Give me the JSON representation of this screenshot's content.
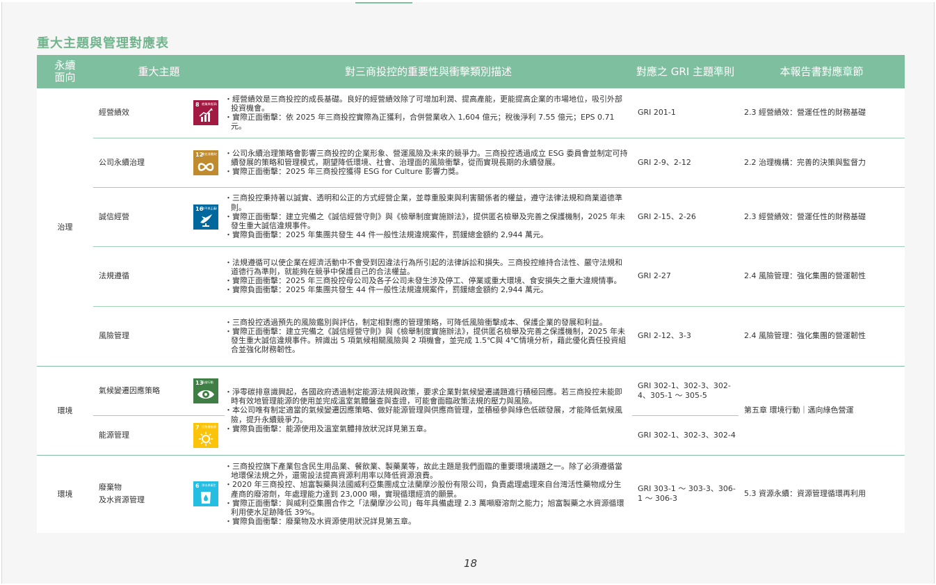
{
  "title": "重大主題與管理對應表",
  "page_number": "18",
  "headers": {
    "pillar": "永續\n面向",
    "topic": "重大主題",
    "description": "對三商投控的重要性與衝擊類別描述",
    "gri": "對應之 GRI 主題準則",
    "section": "本報告書對應章節"
  },
  "colors": {
    "accent": "#7dbf9e",
    "title": "#72b48e",
    "sdg8": "#a21942",
    "sdg12": "#bf8b2e",
    "sdg16": "#00689d",
    "sdg13": "#3f7e44",
    "sdg7": "#fcc30b",
    "sdg6": "#26bde2"
  },
  "sdg_icons": {
    "sdg8": {
      "num": "8",
      "text": "就業與經濟成長",
      "icon": "growth-chart-icon"
    },
    "sdg12": {
      "num": "12",
      "text": "責任消費與生產",
      "icon": "infinity-icon"
    },
    "sdg16": {
      "num": "16",
      "text": "和平與正義制度",
      "icon": "dove-icon"
    },
    "sdg13": {
      "num": "13",
      "text": "氣候行動",
      "icon": "globe-eye-icon"
    },
    "sdg7": {
      "num": "7",
      "text": "可負擔能源",
      "icon": "sun-icon"
    },
    "sdg6": {
      "num": "6",
      "text": "淨水與衛生",
      "icon": "water-drop-icon"
    }
  },
  "governance": {
    "pillar": "治理",
    "rows": [
      {
        "topic": "經營績效",
        "desc": [
          "・經營績效是三商投控的成長基礎。良好的經營績效除了可增加利潤、提高產能，更能提高企業的市場地位，吸引外部投資機會。",
          "・實際正面衝擊：依 2025 年三商投控實際為正獲利，合併營業收入 1,604 億元；稅後淨利 7.55 億元；EPS 0.71 元。"
        ],
        "gri": "GRI 201-1",
        "section": "2.3 經營績效：營運任性的財務基礎"
      },
      {
        "topic": "公司永續治理",
        "desc": [
          "・公司永續治理策略會影響三商投控的企業形象、營運風險及未來的競爭力。三商投控透過成立 ESG 委員會並制定可持續發展的策略和管理模式，期望降低環境、社會、治理面的風險衝擊，從而實現長期的永續發展。",
          "・實際正面衝擊：2025 年三商投控獲得 ESG for Culture 影響力獎。"
        ],
        "gri": "GRI 2-9、2-12",
        "section": "2.2 治理機構：完善的決策與監督力"
      },
      {
        "topic": "誠信經營",
        "desc": [
          "・三商投控秉持著以誠實、透明和公正的方式經營企業，並尊重股東與利害關係者的權益，遵守法律法規和商業道德準則。",
          "・實際正面衝擊：建立完備之《誠信經營守則》與《檢舉制度實施辦法》，提供匿名檢舉及完善之保護機制，2025 年未發生重大誠信違規事件。",
          "・實際負面衝擊：2025 年集團共發生 44 件一般性法規違規案件，罰鍰總金額約 2,944 萬元。"
        ],
        "gri": "GRI 2-15、2-26",
        "section": "2.3 經營績效：營運任性的財務基礎"
      },
      {
        "topic": "法規遵循",
        "desc": [
          "・法規遵循可以使企業在經濟活動中不會受到因違法行為所引起的法律訴訟和損失。三商投控維持合法性、嚴守法規和道德行為準則，就能夠在競爭中保護自己的合法權益。",
          "・實際正面衝擊：2025 年三商投控母公司及各子公司未發生涉及停工、停業或重大環境、食安損失之重大違規情事。",
          "・實際負面衝擊：2025 年集團共發生 44 件一般性法規違規案件，罰鍰總金額約 2,944 萬元。"
        ],
        "gri": "GRI 2-27",
        "section": "2.4 風險管理：強化集團的營運韌性"
      },
      {
        "topic": "風險管理",
        "desc": [
          "・三商投控透過預先的風險鑑別與評估，制定相對應的管理策略，可降低風險衝擊成本、保護企業的發展和利益。",
          "・實際正面衝擊：建立完備之《誠信經營守則》與《檢舉制度實施辦法》，提供匿名檢舉及完善之保護機制，2025 年未發生重大誠信違規事件。辨識出 5 項氣候相關風險與 2 項機會，並完成 1.5℃與 4℃情境分析，藉此優化責任投資組合並強化財務韌性。"
        ],
        "gri": "GRI 2-12、3-3",
        "section": "2.4 風險管理：強化集團的營運韌性"
      }
    ]
  },
  "environment1": {
    "pillar": "環境",
    "rows": [
      {
        "topic": "氣候變遷因應策略",
        "gri": "GRI 302-1、302-3、302-4、305-1 ～ 305-5"
      },
      {
        "topic": "能源管理",
        "gri": "GRI 302-1、302-3、302-4"
      }
    ],
    "desc": [
      "・淨零碳排意識興起，各國政府透過制定能源法規與政策，要求企業對氣候變遷議題進行積極回應。若三商投控未能即時有效地管理能源的使用並完成溫室氣體盤查與查證，可能會面臨政策法規的壓力與風險。",
      "・本公司唯有制定適當的氣候變遷因應策略、做好能源管理與供應商管理，並積極參與綠色低碳發展，才能降低氣候風險，提升永續競爭力。",
      "・實際負面衝擊：能源使用及溫室氣體排放狀況詳見第五章。"
    ],
    "section": "第五章 環境行動｜邁向綠色營運"
  },
  "environment2": {
    "pillar": "環境",
    "topic_line1": "廢棄物",
    "topic_line2": "及水資源管理",
    "desc": [
      "・三商投控旗下產業包含民生用品業、餐飲業、製藥業等，故此主題是我們面臨的重要環境議題之一。除了必須遵循當地環保法規之外，還需設法提高資源利用率以降低資源浪費。",
      "・2020 年三商投控、旭富製藥與法國威利亞集團成立法蘭摩沙股份有限公司，負責處理處理來自台灣活性藥物成分生產商的廢溶劑，年處理能力達到 23,000 噸，實現循環經濟的願景。",
      "・實際正面衝擊：與威利亞集團合作之「法蘭摩沙公司」每年具備處理 2.3 萬噸廢溶劑之能力；旭富製藥之水資源循環利用使水足跡降低 39%。",
      "・實際負面衝擊：廢棄物及水資源使用狀況詳見第五章。"
    ],
    "gri": "GRI 303-1 ～ 303-3、306-1 ～ 306-3",
    "section": "5.3 資源永續：資源管理循環再利用"
  }
}
